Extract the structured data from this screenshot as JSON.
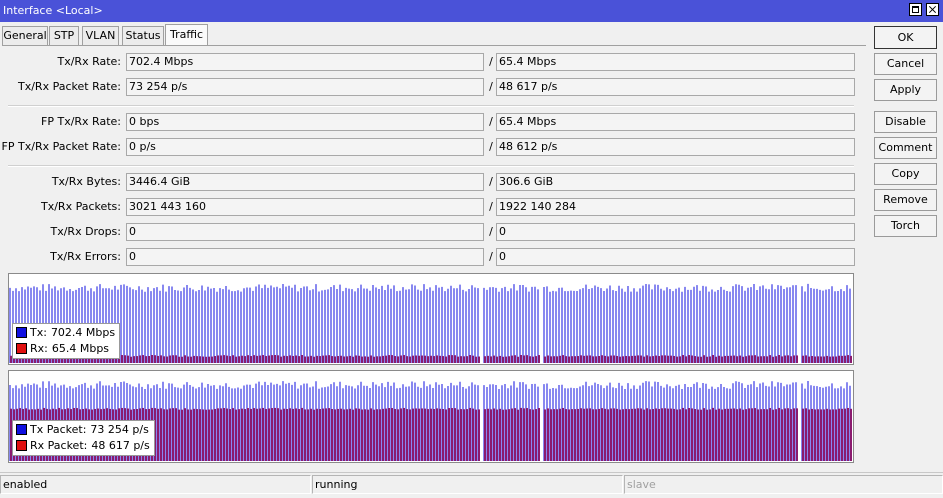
{
  "window": {
    "title": "Interface <Local>"
  },
  "tabs": [
    {
      "label": "General"
    },
    {
      "label": "STP"
    },
    {
      "label": "VLAN"
    },
    {
      "label": "Status"
    },
    {
      "label": "Traffic"
    }
  ],
  "active_tab": "Traffic",
  "stats": {
    "tx_rx_rate": {
      "label": "Tx/Rx Rate:",
      "tx": "702.4 Mbps",
      "rx": "65.4 Mbps"
    },
    "tx_rx_packet_rate": {
      "label": "Tx/Rx Packet Rate:",
      "tx": "73 254 p/s",
      "rx": "48 617 p/s"
    },
    "fp_tx_rx_rate": {
      "label": "FP Tx/Rx Rate:",
      "tx": "0 bps",
      "rx": "65.4 Mbps"
    },
    "fp_tx_rx_packet_rate": {
      "label": "FP Tx/Rx Packet Rate:",
      "tx": "0 p/s",
      "rx": "48 612 p/s"
    },
    "tx_rx_bytes": {
      "label": "Tx/Rx Bytes:",
      "tx": "3446.4 GiB",
      "rx": "306.6 GiB"
    },
    "tx_rx_packets": {
      "label": "Tx/Rx Packets:",
      "tx": "3021 443 160",
      "rx": "1922 140 284"
    },
    "tx_rx_drops": {
      "label": "Tx/Rx Drops:",
      "tx": "0",
      "rx": "0"
    },
    "tx_rx_errors": {
      "label": "Tx/Rx Errors:",
      "tx": "0",
      "rx": "0"
    }
  },
  "separator": "/",
  "graphs": {
    "rate": {
      "tx_label": "Tx:",
      "tx_value": "702.4 Mbps",
      "tx_color": "#1010e0",
      "rx_label": "Rx:",
      "rx_value": "65.4 Mbps",
      "rx_color": "#e01010"
    },
    "packets": {
      "tx_label": "Tx Packet:",
      "tx_value": "73 254 p/s",
      "tx_color": "#1010e0",
      "rx_label": "Rx Packet:",
      "rx_value": "48 617 p/s",
      "rx_color": "#e01010"
    }
  },
  "buttons": {
    "ok": "OK",
    "cancel": "Cancel",
    "apply": "Apply",
    "disable": "Disable",
    "comment": "Comment",
    "copy": "Copy",
    "remove": "Remove",
    "torch": "Torch"
  },
  "status": {
    "state": "enabled",
    "running": "running",
    "slave": "slave"
  }
}
